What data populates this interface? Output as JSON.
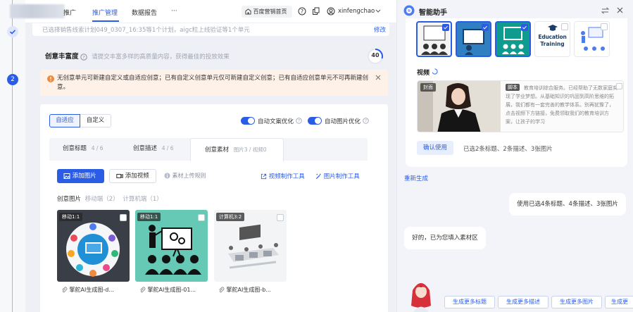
{
  "nav": {
    "items": [
      "推广",
      "推广管理",
      "数据报告",
      "···"
    ],
    "store_button": "百度营销首页",
    "username": "xinfengchao"
  },
  "rail": {
    "step2": "2"
  },
  "main": {
    "selection_summary": "已选择销售线索计划049_0307_16:35等1个计划，aigc粒上线验证等1个单元",
    "modify_link": "修改",
    "richness": {
      "title": "创意丰富度",
      "desc": "请提交丰富多样的高质量内容，获得最佳的投放效果",
      "score": "40"
    },
    "notice_text": "无创意单元可新建自定义或自适应创意；已有自定义创意单元仅可新建自定义创意；已有自适应创意单元不可再新建创意。",
    "mode_tabs": [
      "自适应",
      "自定义"
    ],
    "auto_text_opt": "自动文案优化",
    "auto_image_opt": "自动图片优化",
    "creative_tabs": [
      {
        "label": "创意标题",
        "count": "4 / 6"
      },
      {
        "label": "创意描述",
        "count": "4 / 6"
      },
      {
        "label": "创意素材",
        "count": "图片3 / 视频0"
      }
    ],
    "add_image": "添加图片",
    "add_video": "添加视频",
    "upload_rules": "素材上传规则",
    "video_tool": "视频制作工具",
    "image_tool": "图片制作工具",
    "image_section": {
      "label": "创意图片",
      "mobile": "移动端（2）",
      "pc": "计算机端（1）"
    },
    "images": [
      {
        "tag": "移动1:1",
        "caption": "擎舵AI生成图-d..."
      },
      {
        "tag": "移动1:1",
        "caption": "擎舵AI生成图-01..."
      },
      {
        "tag": "计算机3:2",
        "caption": "擎舵AI生成图-b..."
      }
    ]
  },
  "panel": {
    "title": "智能助手",
    "education_text": [
      "Education",
      "Training"
    ],
    "video_label": "视频",
    "video_tag": "封面",
    "script_tag": "脚本",
    "script_text": "教育培训综合服务。已经帮助了无数家庭实现了学业梦想。从基础知识的巩固到高阶思维的拓展，我们都有一套完善的教学体系。别再犹豫了，点击视频下方链接，免费领取我们的教育培训方案，让孩子的学习",
    "confirm_button": "确认使用",
    "selected_summary": "已选2条标题、2条描述、3张图片",
    "regenerate": "重新生成",
    "user_message": "使用已选4条标题、4条描述、3张图片",
    "bot_reply": "好的，已为您填入素材区",
    "chips": [
      "生成更多标题",
      "生成更多描述",
      "生成更多图片",
      "生成更"
    ]
  },
  "colors": {
    "accent": "#2b5ce6",
    "notice_bg": "#fdf1e8",
    "warn": "#f08a3c",
    "panel_bg": "#f2f4f9"
  }
}
